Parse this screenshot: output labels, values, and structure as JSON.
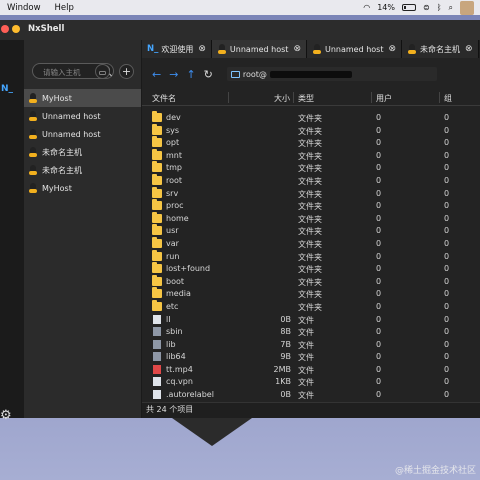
{
  "menubar": {
    "items": [
      "Window",
      "Help"
    ],
    "battery_text": "14%"
  },
  "window": {
    "title": "NxShell",
    "colors": {
      "accent": "#3d8ef0",
      "close": "#ff5f57",
      "minimize": "#febc2e",
      "folder": "#f6c544"
    }
  },
  "leftbar": {
    "logo_text": "N_"
  },
  "sidebar": {
    "search": {
      "placeholder": "请输入主机"
    },
    "hosts": [
      {
        "label": "MyHost",
        "active": true
      },
      {
        "label": "Unnamed host"
      },
      {
        "label": "Unnamed host"
      },
      {
        "label": "未命名主机"
      },
      {
        "label": "未命名主机"
      },
      {
        "label": "MyHost"
      }
    ]
  },
  "tabs": [
    {
      "label": "欢迎使用",
      "icon": "nxshell-logo-icon",
      "logo_text": "N_"
    },
    {
      "label": "Unnamed host",
      "icon": "linux-tux-icon"
    },
    {
      "label": "Unnamed host",
      "icon": "linux-tux-icon"
    },
    {
      "label": "未命名主机",
      "icon": "linux-tux-icon"
    }
  ],
  "tab_close_glyph": "⊗",
  "nav": {
    "path_prefix": "root@"
  },
  "table": {
    "headers": {
      "name": "文件名",
      "size": "大小",
      "type": "类型",
      "user": "用户",
      "group": "组"
    },
    "rows": [
      {
        "name": "dev",
        "size": "",
        "type": "文件夹",
        "user": "0",
        "group": "0",
        "kind": "folder"
      },
      {
        "name": "sys",
        "size": "",
        "type": "文件夹",
        "user": "0",
        "group": "0",
        "kind": "folder"
      },
      {
        "name": "opt",
        "size": "",
        "type": "文件夹",
        "user": "0",
        "group": "0",
        "kind": "folder"
      },
      {
        "name": "mnt",
        "size": "",
        "type": "文件夹",
        "user": "0",
        "group": "0",
        "kind": "folder"
      },
      {
        "name": "tmp",
        "size": "",
        "type": "文件夹",
        "user": "0",
        "group": "0",
        "kind": "folder"
      },
      {
        "name": "root",
        "size": "",
        "type": "文件夹",
        "user": "0",
        "group": "0",
        "kind": "folder"
      },
      {
        "name": "srv",
        "size": "",
        "type": "文件夹",
        "user": "0",
        "group": "0",
        "kind": "folder"
      },
      {
        "name": "proc",
        "size": "",
        "type": "文件夹",
        "user": "0",
        "group": "0",
        "kind": "folder"
      },
      {
        "name": "home",
        "size": "",
        "type": "文件夹",
        "user": "0",
        "group": "0",
        "kind": "folder"
      },
      {
        "name": "usr",
        "size": "",
        "type": "文件夹",
        "user": "0",
        "group": "0",
        "kind": "folder"
      },
      {
        "name": "var",
        "size": "",
        "type": "文件夹",
        "user": "0",
        "group": "0",
        "kind": "folder"
      },
      {
        "name": "run",
        "size": "",
        "type": "文件夹",
        "user": "0",
        "group": "0",
        "kind": "folder"
      },
      {
        "name": "lost+found",
        "size": "",
        "type": "文件夹",
        "user": "0",
        "group": "0",
        "kind": "folder"
      },
      {
        "name": "boot",
        "size": "",
        "type": "文件夹",
        "user": "0",
        "group": "0",
        "kind": "folder"
      },
      {
        "name": "media",
        "size": "",
        "type": "文件夹",
        "user": "0",
        "group": "0",
        "kind": "folder"
      },
      {
        "name": "etc",
        "size": "",
        "type": "文件夹",
        "user": "0",
        "group": "0",
        "kind": "folder"
      },
      {
        "name": "lI",
        "size": "0B",
        "type": "文件",
        "user": "0",
        "group": "0",
        "kind": "file"
      },
      {
        "name": "sbin",
        "size": "8B",
        "type": "文件",
        "user": "0",
        "group": "0",
        "kind": "link"
      },
      {
        "name": "lib",
        "size": "7B",
        "type": "文件",
        "user": "0",
        "group": "0",
        "kind": "link"
      },
      {
        "name": "lib64",
        "size": "9B",
        "type": "文件",
        "user": "0",
        "group": "0",
        "kind": "link"
      },
      {
        "name": "tt.mp4",
        "size": "2MB",
        "type": "文件",
        "user": "0",
        "group": "0",
        "kind": "video"
      },
      {
        "name": "cq.vpn",
        "size": "1KB",
        "type": "文件",
        "user": "0",
        "group": "0",
        "kind": "file"
      },
      {
        "name": ".autorelabel",
        "size": "0B",
        "type": "文件",
        "user": "0",
        "group": "0",
        "kind": "file"
      }
    ]
  },
  "status": {
    "text": "共 24 个项目"
  },
  "watermark": "@稀土掘金技术社区"
}
